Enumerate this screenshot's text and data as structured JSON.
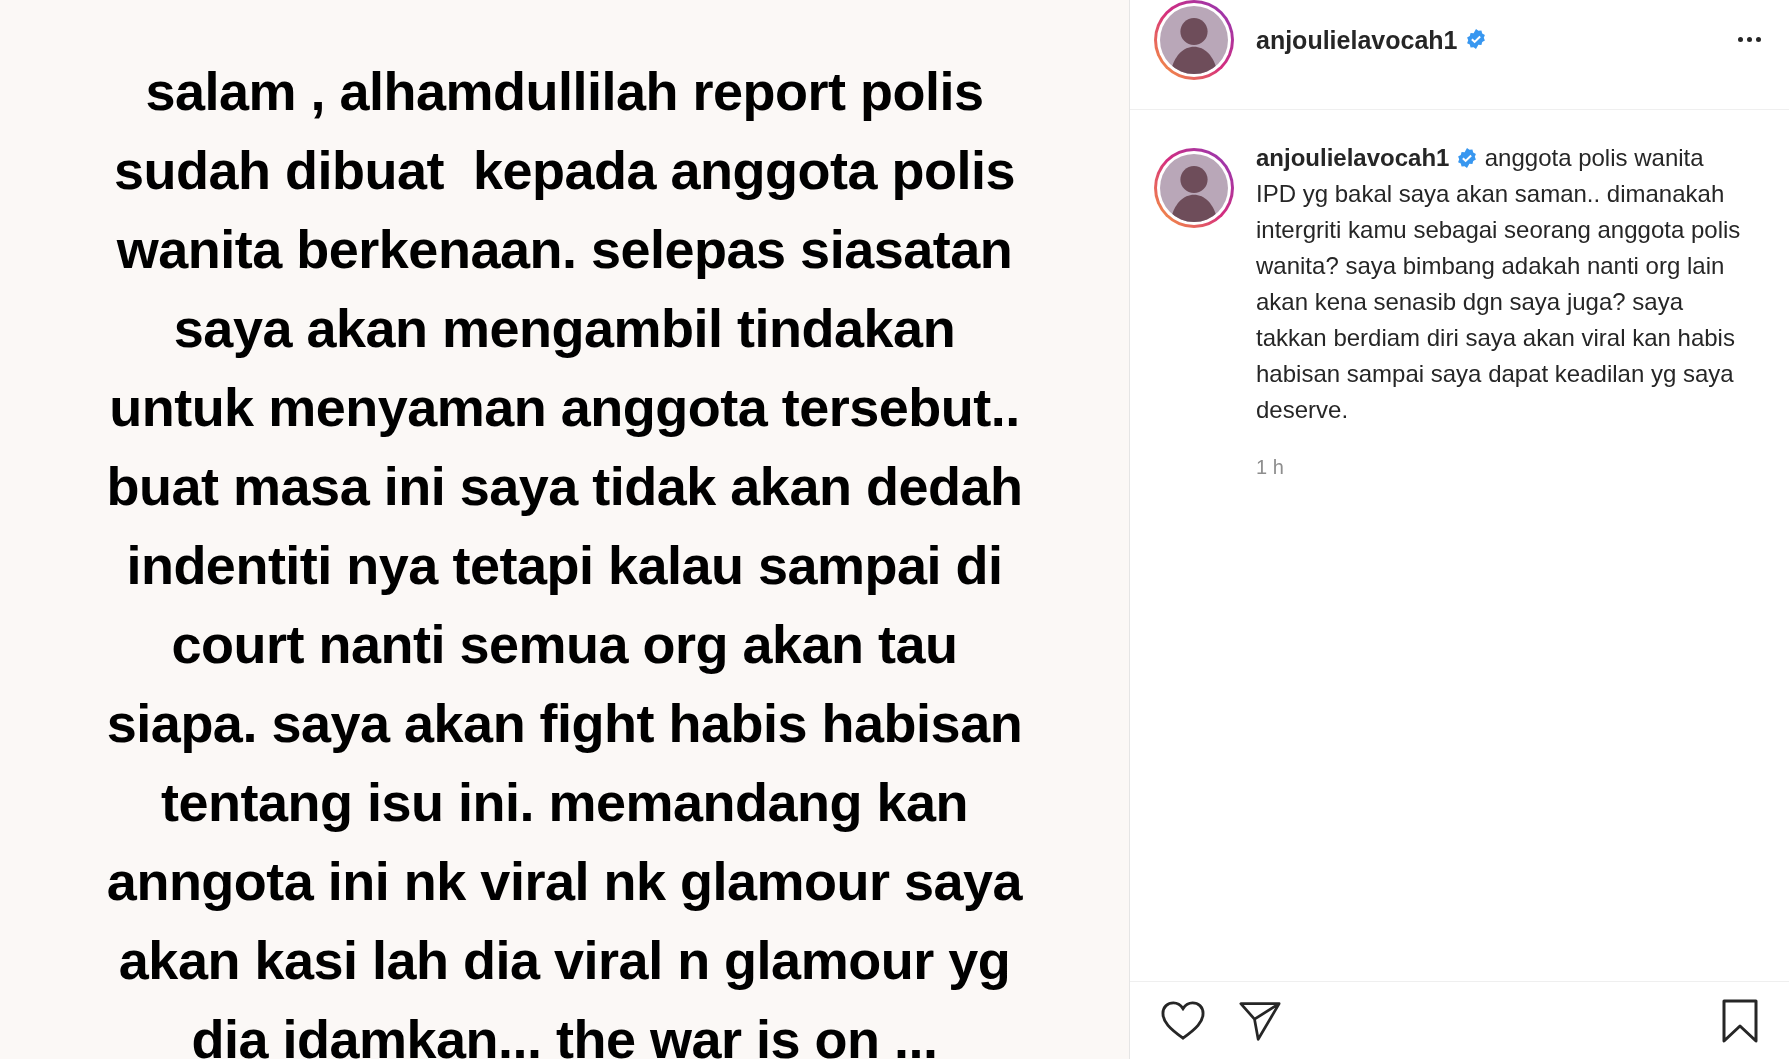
{
  "post_image": {
    "lines": [
      "salam , alhamdullilah report polis",
      "sudah dibuat  kepada anggota polis",
      "wanita berkenaan. selepas siasatan",
      "saya akan mengambil tindakan",
      "untuk menyaman anggota tersebut..",
      "buat masa ini saya tidak akan dedah",
      "indentiti nya tetapi kalau sampai di",
      "court nanti semua org akan tau",
      "siapa. saya akan fight habis habisan",
      "tentang isu ini. memandang kan",
      "anngota ini nk viral nk glamour saya",
      "akan kasi lah dia viral n glamour yg",
      "dia idamkan... the war is on ..."
    ]
  },
  "header": {
    "username": "anjoulielavocah1",
    "verified": true
  },
  "caption": {
    "username": "anjoulielavocah1",
    "verified": true,
    "text": "anggota polis wanita IPD yg bakal saya akan saman.. dimanakah intergriti kamu sebagai seorang anggota polis wanita? saya bimbang adakah nanti org lain akan kena senasib dgn saya juga? saya takkan berdiam diri saya akan viral kan habis habisan sampai saya dapat keadilan yg saya deserve.",
    "time": "1 h"
  },
  "actions": {
    "liked": false,
    "saved": false
  }
}
